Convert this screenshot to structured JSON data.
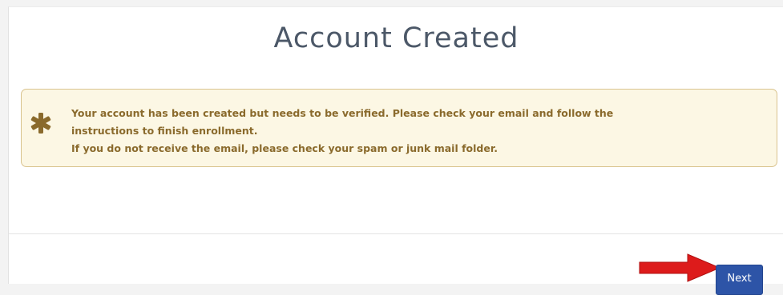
{
  "page": {
    "title": "Account Created"
  },
  "alert": {
    "icon": "asterisk-icon",
    "lines": [
      "Your account has been created but needs to be verified. Please check your email and follow the",
      "instructions to finish enrollment.",
      "If you do not receive the email, please check your spam or junk mail folder."
    ],
    "background_color": "#fcf7e4",
    "text_color": "#8a6a2c",
    "icon_color": "#8a6a2c"
  },
  "footer": {
    "next_label": "Next",
    "next_button_color": "#2d54a7",
    "arrow_icon": "red-arrow-icon",
    "arrow_color": "#dd1b1b"
  }
}
